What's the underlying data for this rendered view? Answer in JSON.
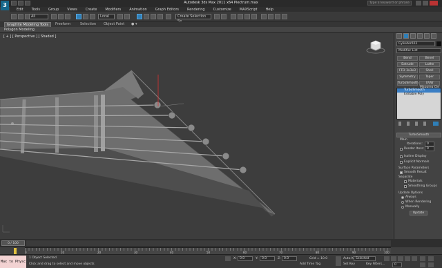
{
  "title": {
    "text": "Autodesk 3ds Max 2011 x64    Plectrum.max",
    "search_placeholder": "Type a keyword or phrase"
  },
  "menu": [
    "Edit",
    "Tools",
    "Group",
    "Views",
    "Create",
    "Modifiers",
    "Animation",
    "Graph Editors",
    "Rendering",
    "Customize",
    "MAXScript",
    "Help"
  ],
  "toolbar": {
    "selset": "All",
    "refcoord": "Local",
    "namedsel": "Create Selection Se"
  },
  "ribbon": {
    "tabs": [
      "Graphite Modeling Tools",
      "Freeform",
      "Selection",
      "Object Paint"
    ],
    "panel": "Polygon Modeling"
  },
  "viewport": {
    "label": "[ + ] [ Perspective ] [ Shaded ]"
  },
  "command_panel": {
    "object_name": "Cylinder022",
    "modifier_list": "Modifier List",
    "buttons": [
      [
        "Bend",
        "Bevel"
      ],
      [
        "Extrude",
        "Lathe"
      ],
      [
        "FFD 3x3x3",
        "Shell"
      ],
      [
        "Symmetry",
        "Taper"
      ],
      [
        "TurboSmooth",
        "UVW Mapping Cle"
      ]
    ],
    "stack": [
      "TurboSmooth",
      "Editable Poly"
    ],
    "rollout": "TurboSmooth",
    "main": "Main",
    "iterations_label": "Iterations:",
    "iterations": "0",
    "render_iters_label": "Render Iters:",
    "render_iters": "0",
    "isoline": "Isoline Display",
    "explicit": "Explicit Normals",
    "surface": "Surface Parameters",
    "smooth_result": "Smooth Result",
    "separate": "Separate",
    "materials": "Materials",
    "smoothing_groups": "Smoothing Groups",
    "update_options": "Update Options",
    "always": "Always",
    "when_rendering": "When Rendering",
    "manually": "Manually",
    "update": "Update"
  },
  "time": {
    "slider": "0 / 100",
    "ticks": [
      "0",
      "10",
      "20",
      "30",
      "40",
      "50",
      "60",
      "70",
      "80",
      "90",
      "100"
    ]
  },
  "status": {
    "maxscript": "Max to Physc",
    "selected": "1 Object Selected",
    "prompt": "Click and drag to select and move objects",
    "x": "0.0",
    "y": "0.0",
    "z": "0.0",
    "grid": "Grid = 10.0",
    "autokey": "Auto Key",
    "selected_dd": "Selected",
    "setkey": "Set Key",
    "keyfilters": "Key Filters...",
    "addtimetag": "Add Time Tag",
    "frame": "0"
  },
  "colors": {
    "accent": "#2f7fb8",
    "selected_stack": "#3a7ec4"
  }
}
